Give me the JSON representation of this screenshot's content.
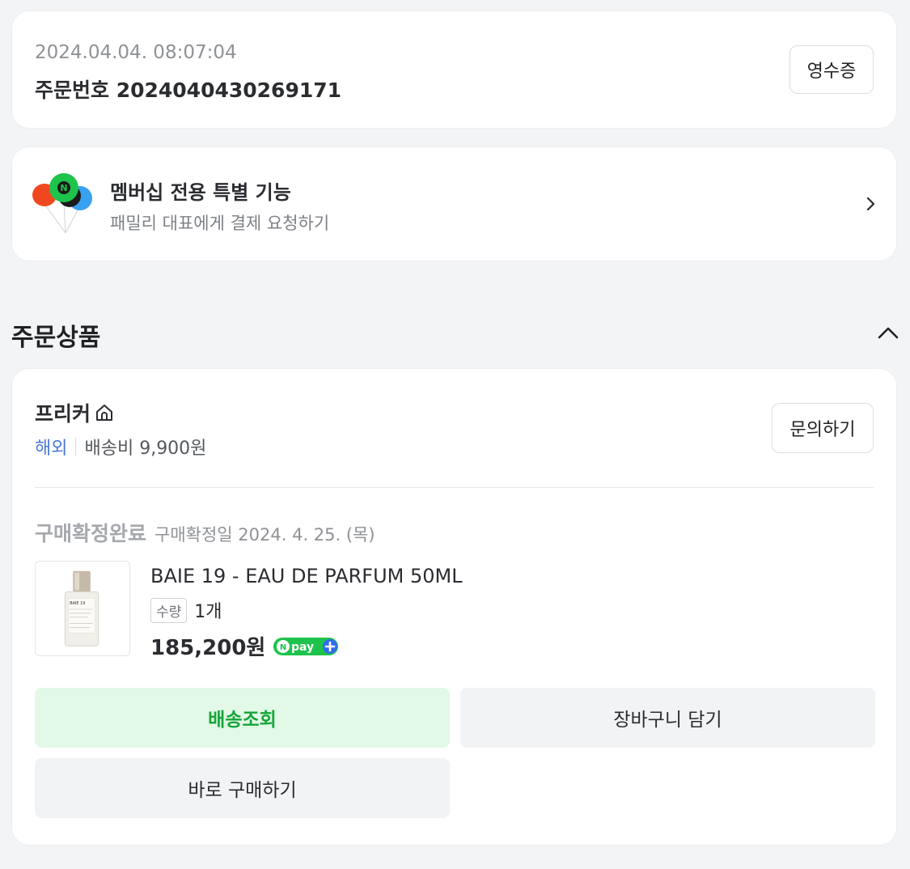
{
  "order": {
    "datetime": "2024.04.04. 08:07:04",
    "number_label": "주문번호 2024040430269171",
    "receipt_button": "영수증"
  },
  "membership": {
    "title": "멤버십 전용 특별 기능",
    "subtitle": "패밀리 대표에게 결제 요청하기",
    "icon": "balloons-icon"
  },
  "section": {
    "title": "주문상품"
  },
  "store": {
    "name": "프리커",
    "origin": "해외",
    "shipping_fee": "배송비 9,900원",
    "inquiry_button": "문의하기"
  },
  "item": {
    "status": "구매확정완료",
    "confirm_date": "구매확정일 2024. 4. 25. (목)",
    "name": "BAIE 19 - EAU DE PARFUM 50ML",
    "qty_label": "수량",
    "qty_value": "1개",
    "price": "185,200원",
    "pay_badge": "Npay+",
    "thumb_label": "BAIE 19"
  },
  "actions": {
    "track": "배송조회",
    "cart": "장바구니 담기",
    "buy_now": "바로 구매하기"
  },
  "colors": {
    "accent_green": "#17a43b",
    "track_bg": "#e1f9e6",
    "origin_blue": "#4a79d4"
  }
}
